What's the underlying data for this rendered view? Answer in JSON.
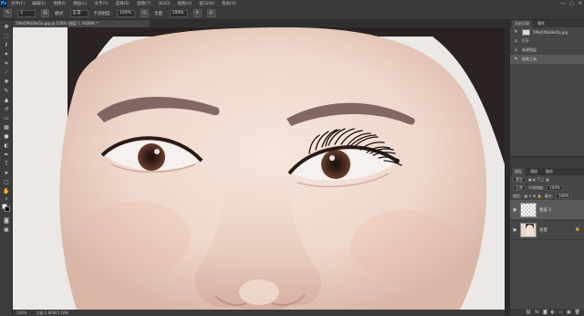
{
  "app": {
    "logo": "Ps"
  },
  "menubar": {
    "items": [
      "文件(F)",
      "编辑(E)",
      "图像(I)",
      "图层(L)",
      "文字(Y)",
      "选择(S)",
      "滤镜(T)",
      "3D(D)",
      "视图(V)",
      "窗口(W)",
      "帮助(H)"
    ],
    "controls": [
      "—",
      "□",
      "×"
    ]
  },
  "options": {
    "brush_size": "3",
    "mode_label": "模式:",
    "mode_value": "正常",
    "opacity_label": "不透明度:",
    "opacity_value": "100%",
    "flow_label": "流量:",
    "flow_value": "100%"
  },
  "document": {
    "tab_title": "5f9e5f9b39e5a.jpg @ 100% (图层 1, RGB/8) *"
  },
  "status": {
    "zoom": "100%",
    "doc_info": "文档:2.86M/5.16M"
  },
  "history": {
    "tabs": [
      "历史记录",
      "属性"
    ],
    "snapshot": "5f9e5f9b39e5a.jpg",
    "steps": [
      {
        "icon": "document-icon",
        "label": "打开"
      },
      {
        "icon": "layer-icon",
        "label": "新建图层"
      },
      {
        "icon": "brush-icon",
        "label": "画笔工具"
      }
    ]
  },
  "layers": {
    "tabs": [
      "图层",
      "通道",
      "路径"
    ],
    "kind_label": "类型",
    "blend_mode": "正常",
    "opacity_label": "不透明度:",
    "opacity_value": "100%",
    "lock_label": "锁定:",
    "fill_label": "填充:",
    "fill_value": "100%",
    "items": [
      {
        "name": "图层 1",
        "active": true
      },
      {
        "name": "背景",
        "active": false
      }
    ]
  },
  "colors": {
    "ui_dark": "#3b3b3b",
    "panel": "#464646",
    "accent": "#31a8ff",
    "skin": "#efd9cf",
    "hair": "#2b2322",
    "brow": "#6a4f4d",
    "iris": "#4a2f24"
  }
}
